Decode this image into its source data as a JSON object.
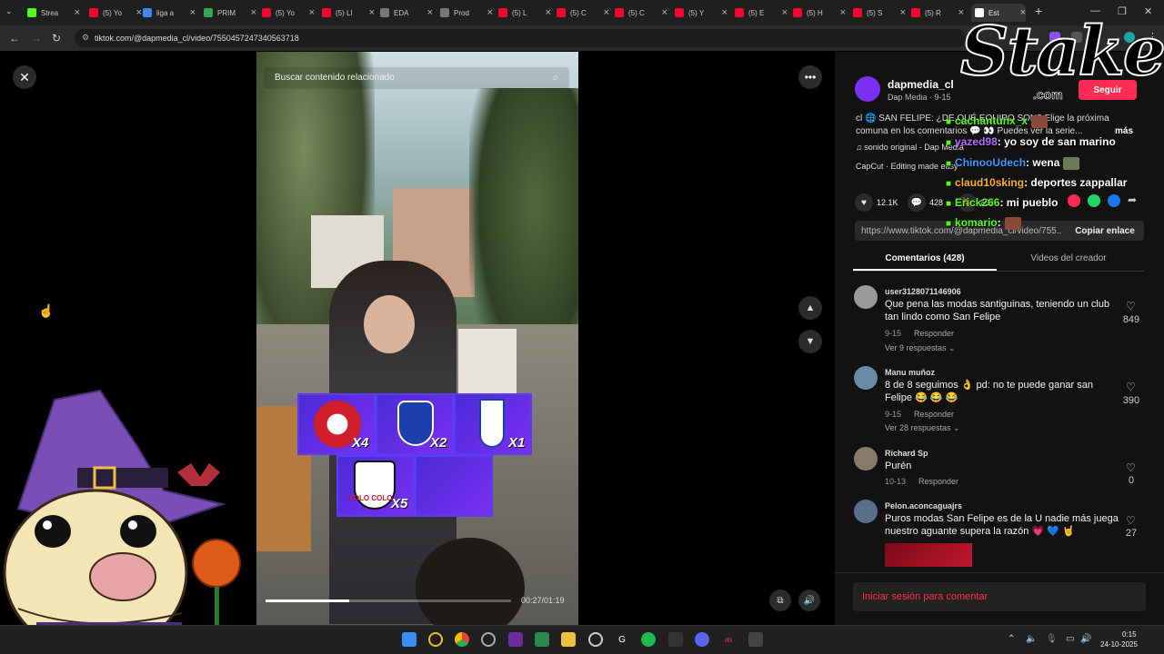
{
  "browser": {
    "tabs": [
      {
        "label": "Strea",
        "favicon": "#53fc18"
      },
      {
        "label": "(5) Yo",
        "favicon": "#ff0033"
      },
      {
        "label": "liga a",
        "favicon": "#4285f4"
      },
      {
        "label": "PRIM",
        "favicon": "#34a853"
      },
      {
        "label": "(5) Yo",
        "favicon": "#ff0033"
      },
      {
        "label": "(5) LI",
        "favicon": "#ff0033"
      },
      {
        "label": "EDA",
        "favicon": "#777777"
      },
      {
        "label": "Prod",
        "favicon": "#777777"
      },
      {
        "label": "(5) L",
        "favicon": "#ff0033"
      },
      {
        "label": "(5) C",
        "favicon": "#ff0033"
      },
      {
        "label": "(5) C",
        "favicon": "#ff0033"
      },
      {
        "label": "(5) Y",
        "favicon": "#ff0033"
      },
      {
        "label": "(5) E",
        "favicon": "#ff0033"
      },
      {
        "label": "(5) H",
        "favicon": "#ff0033"
      },
      {
        "label": "(5) S",
        "favicon": "#ff0033"
      },
      {
        "label": "(5) R",
        "favicon": "#ff0033"
      },
      {
        "label": "Est",
        "favicon": "#ffffff"
      }
    ],
    "new_tab": "+",
    "url": "tiktok.com/@dapmedia_cl/video/7550457247340563718"
  },
  "video": {
    "search_placeholder": "Buscar contenido relacionado",
    "time": "00:27/01:19",
    "progress": 0.34,
    "multipliers": [
      "X4",
      "X2",
      "X1",
      "X5"
    ],
    "crest_labels": [
      "COLO COLO"
    ]
  },
  "creator": {
    "name": "dapmedia_cl",
    "sub": "Dap Media · 9-15",
    "follow": "Seguir"
  },
  "description": {
    "line1": "cl 🌐 SAN FELIPE: ¿DE QUÉ EQUIPO SON? Elige la próxima",
    "line2": "comuna en los comentarios 💬 👀 Puedes ver la serie...",
    "more": "más",
    "music": "♫  sonido original - Dap Media",
    "capcut": "CapCut · Editing made easy"
  },
  "stats": {
    "likes": "12.1K",
    "comments": "428",
    "saves": "628"
  },
  "share_colors": [
    "#fe2c55",
    "#25d366",
    "#1877f2"
  ],
  "link": {
    "url": "https://www.tiktok.com/@dapmedia_cl/video/755...",
    "copy": "Copiar enlace"
  },
  "tabs": {
    "comments": "Comentarios (428)",
    "creator_videos": "Videos del creador"
  },
  "comments": [
    {
      "user": "user3128071146906",
      "text": "Que pena las modas santiguinas, teniendo un club tan lindo como San Felipe",
      "date": "9-15",
      "reply": "Responder",
      "views": "Ver 9 respuestas ⌄",
      "likes": "849",
      "avatar": "#9a9a9a"
    },
    {
      "user": "Manu muñoz",
      "text": "8 de 8 seguimos 👌 pd: no te puede ganar san Felipe 😂 😂 😂",
      "date": "9-15",
      "reply": "Responder",
      "views": "Ver 28 respuestas ⌄",
      "likes": "390",
      "avatar": "#6b8aa8"
    },
    {
      "user": "Richard Sp",
      "text": "Purén",
      "date": "10-13",
      "reply": "Responder",
      "views": "",
      "likes": "0",
      "avatar": "#8a7a6a"
    },
    {
      "user": "Pelon.aconcaguajrs",
      "text": "Puros modas San Felipe es de la U nadie más juega nuestro aguante supera la razón 💗 💙 🤘",
      "date": "",
      "reply": "",
      "views": "",
      "likes": "27",
      "avatar": "#5a6e8a"
    }
  ],
  "login": "Iniciar sesión para comentar",
  "overlay": {
    "logo": "Stake",
    "logo_sub": ".com",
    "chat": [
      {
        "user": "cachantunx_x",
        "msg": "",
        "color": "#53fc18"
      },
      {
        "user": "yazed98",
        "msg": ": yo soy de san marino",
        "color": "#b06cff"
      },
      {
        "user": "ChinooUdech",
        "msg": ": wena",
        "color": "#3b9cff"
      },
      {
        "user": "claud10sking",
        "msg": ": deportes zappallar",
        "color": "#ffb020"
      },
      {
        "user": "Erick266",
        "msg": ": mi pueblo",
        "color": "#53fc18"
      },
      {
        "user": "komario",
        "msg": ":",
        "color": "#53fc18"
      }
    ]
  },
  "taskbar": {
    "time": "0:15",
    "date": "24-10-2025"
  }
}
